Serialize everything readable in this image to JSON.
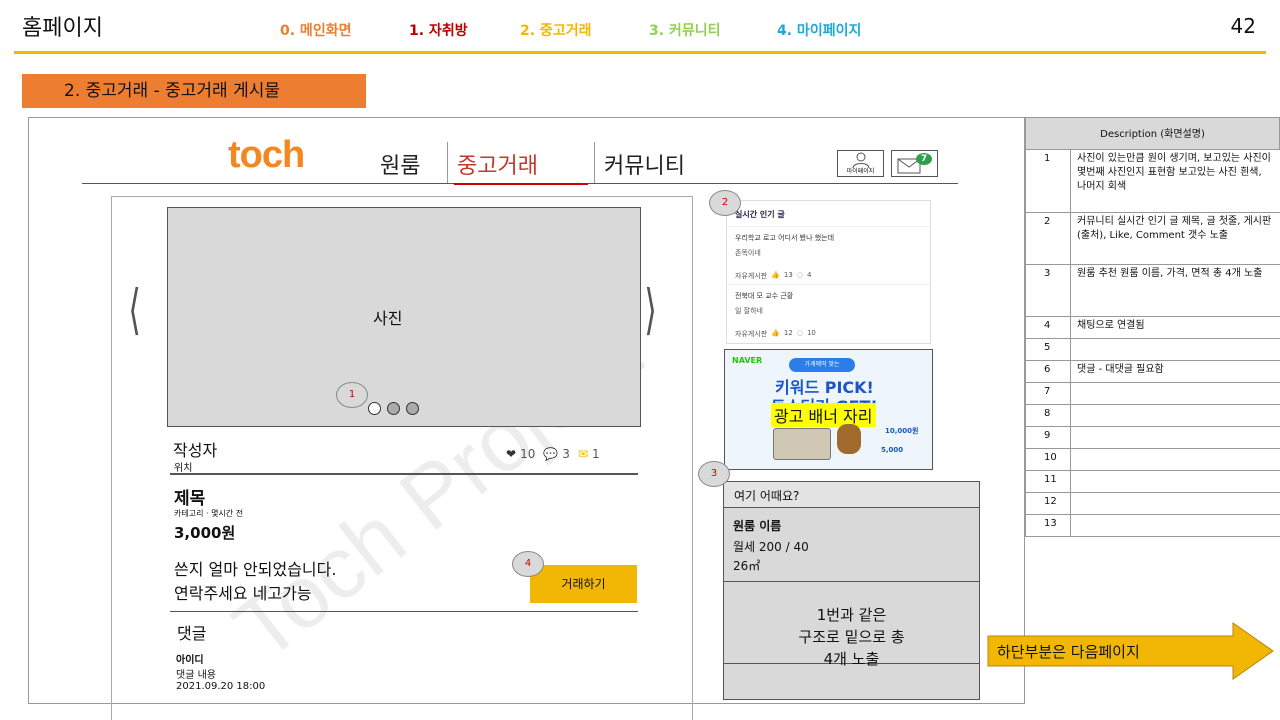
{
  "header": {
    "title": "홈페이지",
    "page_number": "42",
    "nav": [
      {
        "label": "0. 메인화면",
        "color": "#ed7d31"
      },
      {
        "label": "1. 자취방",
        "color": "#c00000"
      },
      {
        "label": "2. 중고거래",
        "color": "#f2b705"
      },
      {
        "label": "3. 커뮤니티",
        "color": "#92d050"
      },
      {
        "label": "4. 마이페이지",
        "color": "#1fa8d8"
      }
    ]
  },
  "section_banner": "2. 중고거래 - 중고거래 게시물",
  "site": {
    "logo": "toch",
    "tabs": [
      "원룸",
      "중고거래",
      "커뮤니티"
    ],
    "mypage_label": "마이페이지",
    "message_count": "7"
  },
  "post": {
    "photo_label": "사진",
    "author_label": "작성자",
    "location": "위치",
    "likes": "10",
    "comments": "3",
    "messages": "1",
    "title": "제목",
    "meta": "카테고리 · 몇시간 전",
    "price": "3,000원",
    "body_line1": "쓴지 얼마 안되었습니다.",
    "body_line2": "연락주세요 네고가능",
    "deal_button": "거래하기",
    "comment_section": "댓글",
    "comment_user": "아이디",
    "comment_text": "댓글 내용",
    "comment_date": "2021.09.20 18:00"
  },
  "popular": {
    "heading": "실시간 인기 글",
    "items": [
      {
        "title": "우리학교 로고 어디서 봤나 했는데",
        "sub": "존똑이네",
        "board": "자유게시판",
        "likes": "13",
        "comments": "4"
      },
      {
        "title": "전북대 모 교수 근황",
        "sub": "일 잘하네",
        "board": "자유게시판",
        "likes": "12",
        "comments": "10"
      }
    ]
  },
  "ad": {
    "brand": "NAVER",
    "pill": "가게에딱 맞는",
    "headline1": "키워드 PICK!",
    "headline2": "토스터기 GET!",
    "overlay": "광고 배너 자리",
    "amount1": "10,000원",
    "amount2": "5,000"
  },
  "recommend": {
    "heading": "여기 어때요?",
    "name": "원룸 이름",
    "price": "월세 200 / 40",
    "area": "26㎡",
    "note_line1": "1번과 같은",
    "note_line2": "구조로 밑으로 총",
    "note_line3": "4개 노출"
  },
  "callouts": [
    "1",
    "2",
    "3",
    "4"
  ],
  "next_page": "하단부분은 다음페이지",
  "watermark": "Toch Project",
  "description": {
    "heading": "Description (화면설명)",
    "rows": [
      {
        "n": "1",
        "text": "사진이 있는만큼 원이 생기며, 보고있는 사진이 몇번째 사진인지 표현함 보고있는 사진 흰색, 나머지 회색"
      },
      {
        "n": "2",
        "text": "커뮤니티 실시간 인기 글 제목, 글 첫줄, 게시판(출처), Like, Comment 갯수 노출"
      },
      {
        "n": "3",
        "text": "원룸 추천 원룸 이름, 가격, 면적 총 4개 노출"
      },
      {
        "n": "4",
        "text": "채팅으로 연결됨"
      },
      {
        "n": "5",
        "text": ""
      },
      {
        "n": "6",
        "text": "댓글 - 대댓글 필요함"
      },
      {
        "n": "7",
        "text": ""
      },
      {
        "n": "8",
        "text": ""
      },
      {
        "n": "9",
        "text": ""
      },
      {
        "n": "10",
        "text": ""
      },
      {
        "n": "11",
        "text": ""
      },
      {
        "n": "12",
        "text": ""
      },
      {
        "n": "13",
        "text": ""
      }
    ]
  }
}
